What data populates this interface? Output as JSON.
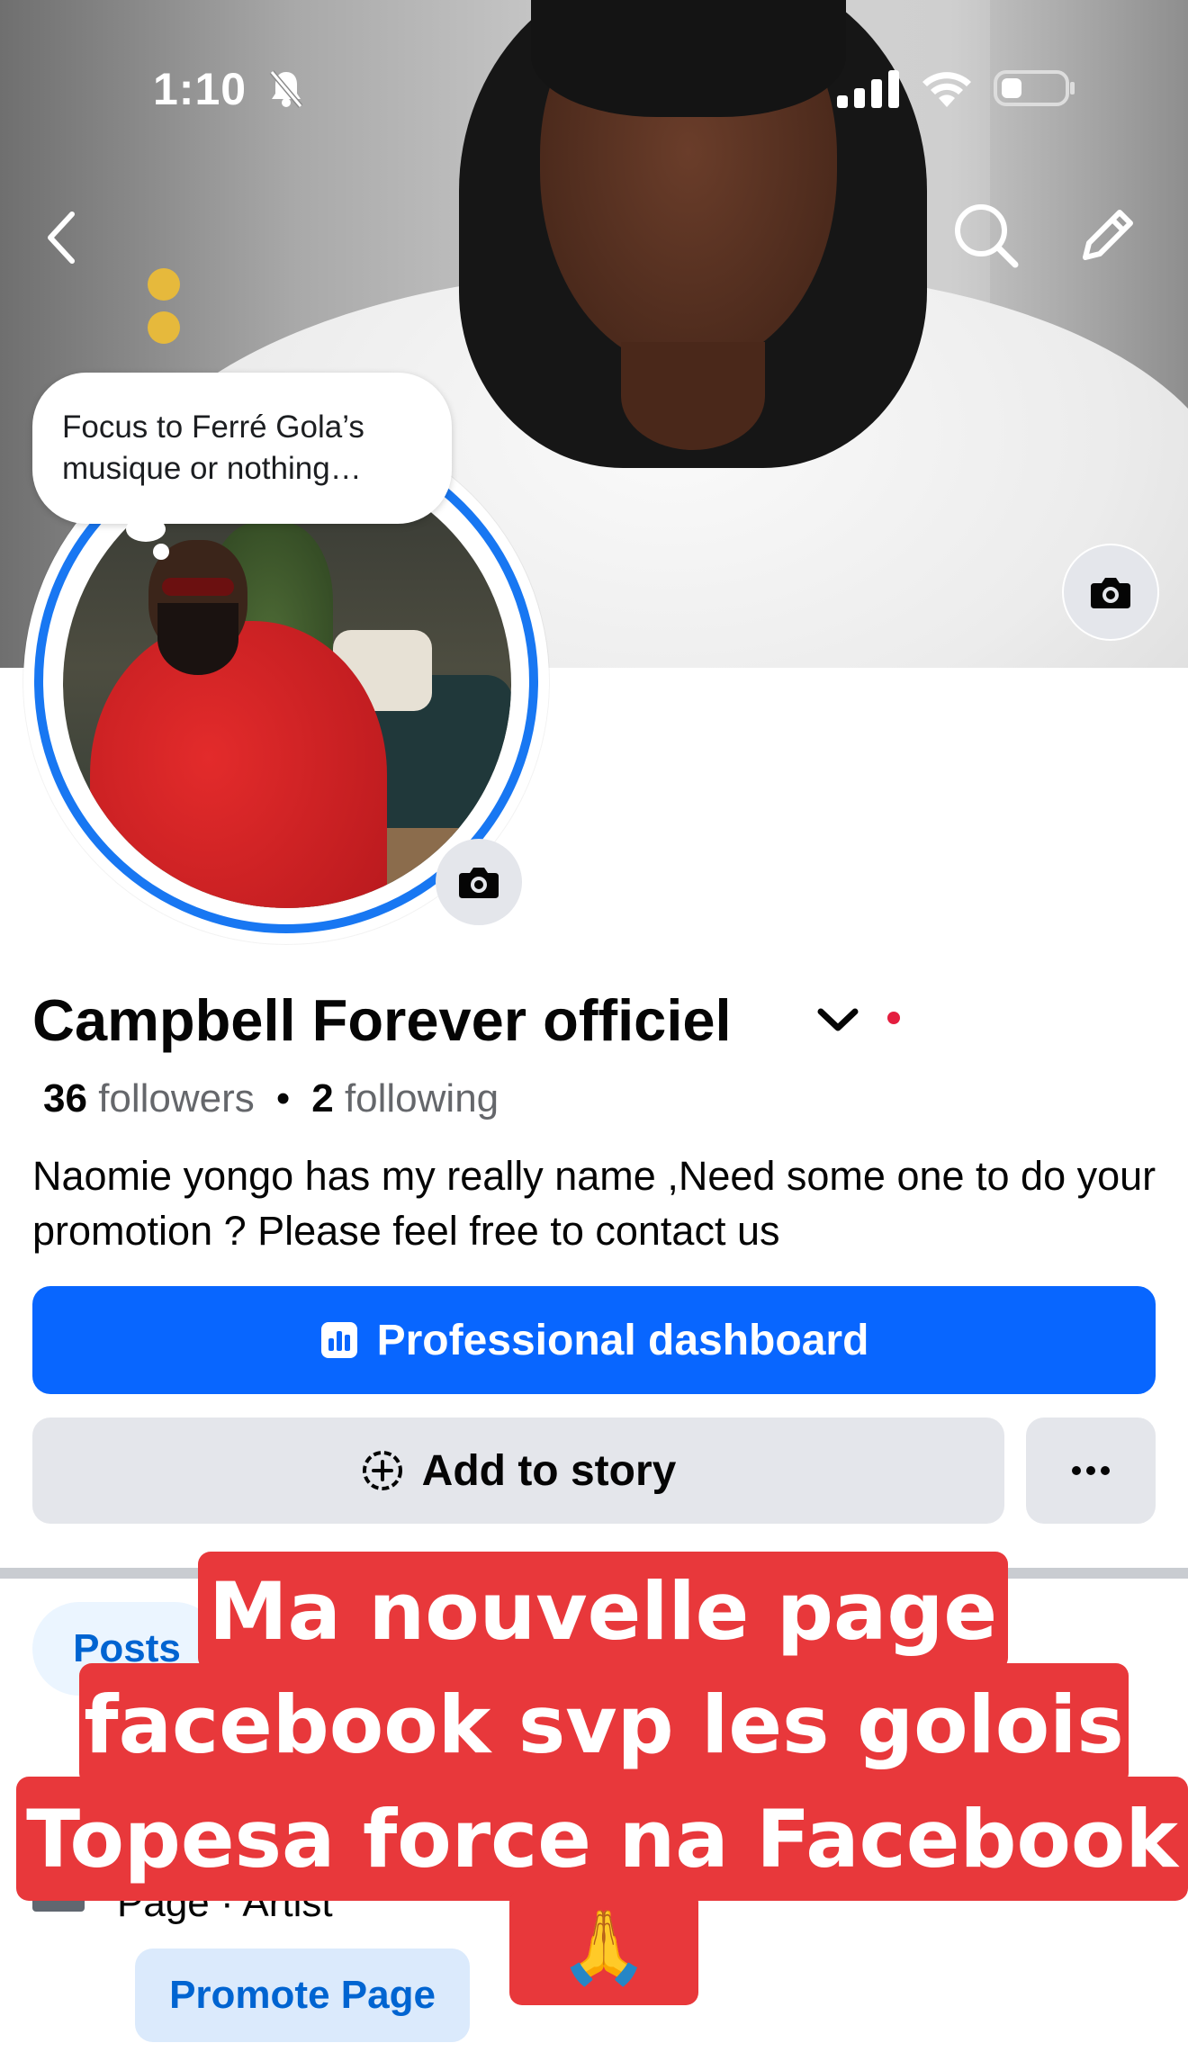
{
  "status_bar": {
    "time": "1:10",
    "icons": [
      "bell-slash-icon",
      "signal-icon",
      "wifi-icon",
      "battery-icon"
    ]
  },
  "nav": {
    "back_icon": "chevron-left-icon",
    "search_icon": "search-icon",
    "edit_icon": "pencil-icon",
    "cover_camera_icon": "camera-icon"
  },
  "note_bubble": {
    "text": "Focus to Ferré Gola’s musique or nothing…"
  },
  "profile": {
    "name": "Campbell Forever officiel",
    "followers_count": "36",
    "followers_label": "followers",
    "separator": "•",
    "following_count": "2",
    "following_label": "following",
    "bio": "Naomie yongo has my really name ,Need some one  to do your promotion ? Please feel free to contact us"
  },
  "buttons": {
    "professional_dashboard": "Professional dashboard",
    "add_to_story": "Add to story",
    "more": "···"
  },
  "tabs": {
    "posts": "Posts"
  },
  "details": {
    "page_type": "Page · Artist",
    "promote": "Promote Page"
  },
  "overlay_caption": {
    "line1": "Ma nouvelle page",
    "line2": "facebook svp les golois",
    "line3": "Topesa force na Facebook",
    "line4": "🙏"
  },
  "colors": {
    "accent": "#0866ff",
    "ring": "#1877f2",
    "caption_bg": "#e8383b",
    "chip_bg": "#ebf5ff"
  }
}
